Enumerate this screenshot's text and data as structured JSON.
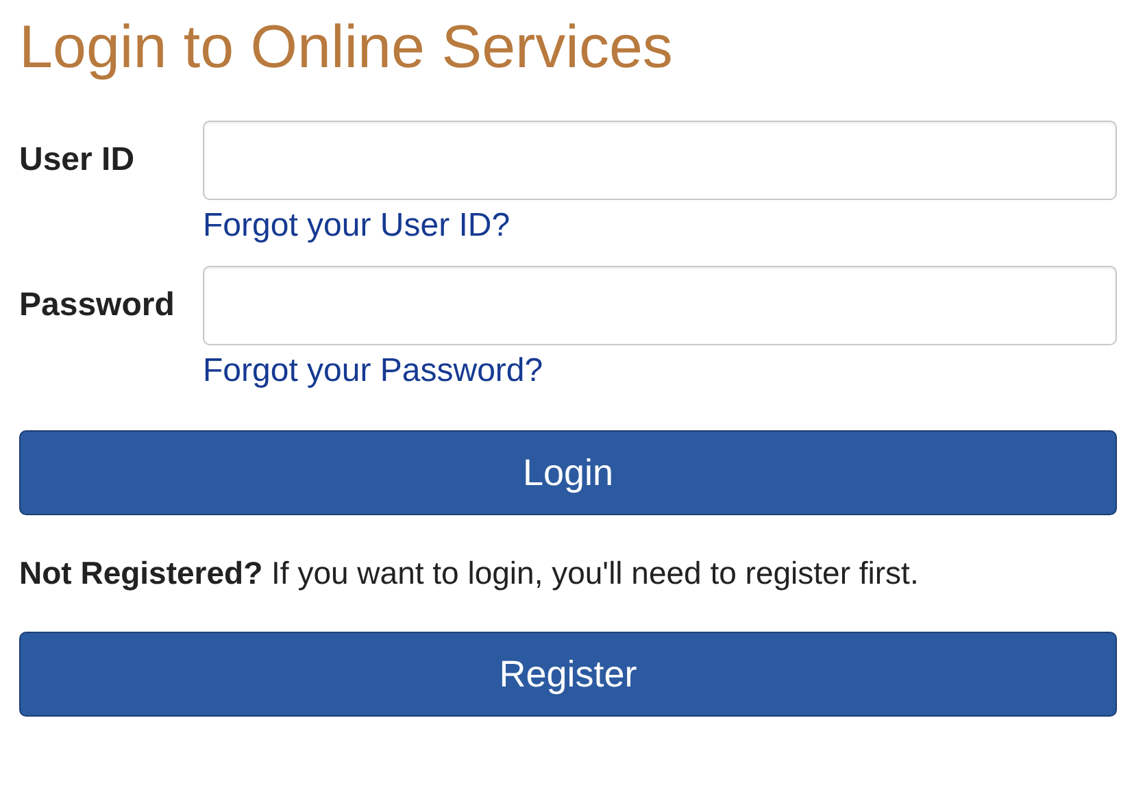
{
  "title": "Login to Online Services",
  "fields": [
    {
      "label": "User ID",
      "link": "Forgot your User ID?"
    },
    {
      "label": "Password",
      "link": "Forgot your Password?"
    }
  ],
  "login_button": "Login",
  "note": "**Not Registered?** If you want to login, you'll need to register first.",
  "register_button": "Register"
}
